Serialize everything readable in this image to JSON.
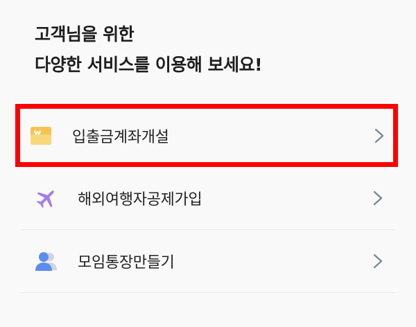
{
  "heading": {
    "line1": "고객님을 위한",
    "line2": "다양한 서비스를 이용해 보세요!"
  },
  "services": [
    {
      "label": "입출금계좌개설",
      "icon": "won-wallet-icon",
      "color": "#f6c350"
    },
    {
      "label": "해외여행자공제가입",
      "icon": "airplane-icon",
      "color": "#a27ee8"
    },
    {
      "label": "모임통장만들기",
      "icon": "group-people-icon",
      "color": "#5b8def"
    }
  ],
  "colors": {
    "highlight_border": "#ff0000",
    "chevron": "#6e8796"
  }
}
